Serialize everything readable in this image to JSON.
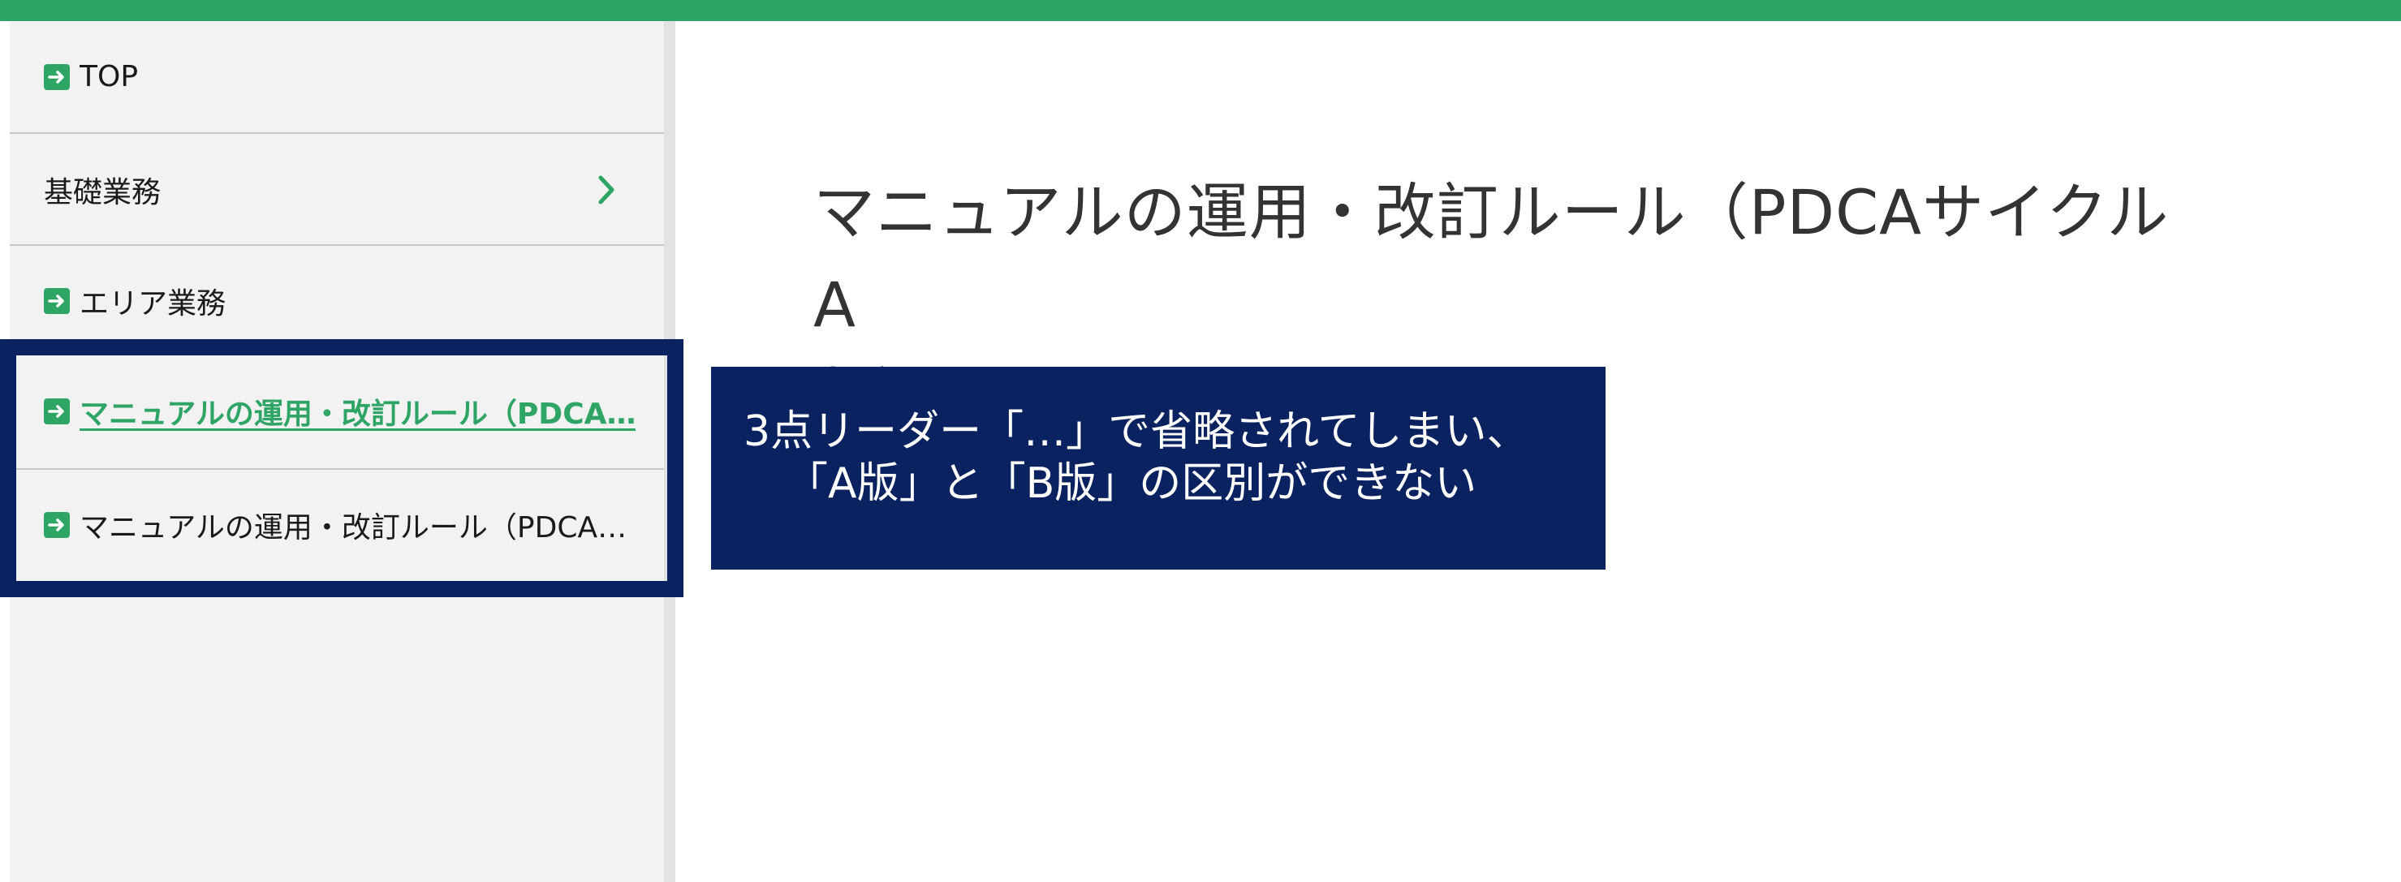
{
  "colors": {
    "brand_green": "#2ea565",
    "callout_navy": "#0b2260",
    "sidebar_bg": "#f2f2f2"
  },
  "sidebar": {
    "items": [
      {
        "label": "TOP",
        "icon": "arrow-right-square-icon"
      },
      {
        "label": "基礎業務",
        "icon": "chevron-right-icon"
      },
      {
        "label": "エリア業務",
        "icon": "arrow-right-square-icon"
      },
      {
        "label": "マニュアルの運用・改訂ルール（PDCA…",
        "icon": "arrow-right-square-icon",
        "active": true
      },
      {
        "label": "マニュアルの運用・改訂ルール（PDCA…",
        "icon": "arrow-right-square-icon"
      }
    ]
  },
  "main": {
    "title_line1": "マニュアルの運用・改訂ルール（PDCAサイクル　A",
    "title_line2": "版）"
  },
  "annotation": {
    "line1": "3点リーダー「…」で省略されてしまい、",
    "line2": "「A版」と「B版」の区別ができない"
  }
}
